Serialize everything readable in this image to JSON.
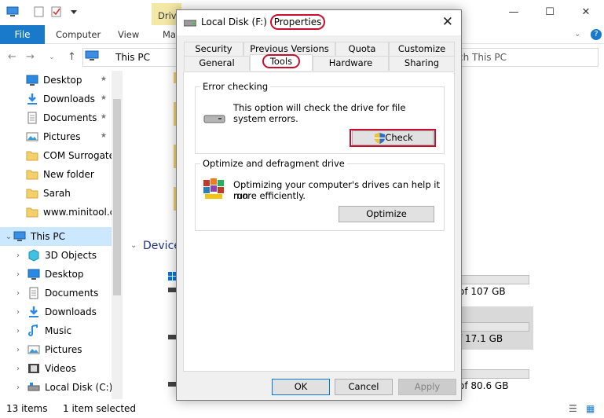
{
  "explorer": {
    "ribbon_contextual_tab": "Drive",
    "ribbon_tabs": [
      "File",
      "Computer",
      "View",
      "Ma"
    ],
    "address": "This PC",
    "search_placeholder": "ch This PC",
    "nav_items": [
      {
        "label": "Desktop",
        "icon": "desktop-icon",
        "pinned": true
      },
      {
        "label": "Downloads",
        "icon": "downloads-icon",
        "pinned": true
      },
      {
        "label": "Documents",
        "icon": "documents-icon",
        "pinned": true
      },
      {
        "label": "Pictures",
        "icon": "pictures-icon",
        "pinned": true
      },
      {
        "label": "COM Surrogate",
        "icon": "folder-icon",
        "pinned": false
      },
      {
        "label": "New folder",
        "icon": "folder-icon",
        "pinned": false
      },
      {
        "label": "Sarah",
        "icon": "folder-icon",
        "pinned": false
      },
      {
        "label": "www.minitool.cc",
        "icon": "folder-icon",
        "pinned": false
      },
      {
        "label": "This PC",
        "icon": "this-pc-icon",
        "pinned": false,
        "selected": true,
        "expanded": true
      },
      {
        "label": "3D Objects",
        "icon": "3d-objects-icon",
        "pinned": false
      },
      {
        "label": "Desktop",
        "icon": "desktop-icon",
        "pinned": false
      },
      {
        "label": "Documents",
        "icon": "documents-icon",
        "pinned": false
      },
      {
        "label": "Downloads",
        "icon": "downloads-icon",
        "pinned": false
      },
      {
        "label": "Music",
        "icon": "music-icon",
        "pinned": false
      },
      {
        "label": "Pictures",
        "icon": "pictures-icon",
        "pinned": false
      },
      {
        "label": "Videos",
        "icon": "videos-icon",
        "pinned": false
      },
      {
        "label": "Local Disk (C:)",
        "icon": "local-disk-icon",
        "pinned": false
      }
    ],
    "devices_header": "Device",
    "drives": [
      {
        "label_suffix": ":)",
        "capacity": "of 107 GB",
        "used_fraction": 0.0
      },
      {
        "label_suffix": ")",
        "capacity": "f 17.1 GB",
        "used_fraction": 0.0
      },
      {
        "label_suffix": ")",
        "capacity": "of 80.6 GB",
        "used_fraction": 0.0
      }
    ],
    "status": {
      "items": "13 items",
      "selected": "1 item selected"
    }
  },
  "dialog": {
    "title_prefix": "Local Disk (F:)",
    "title_suffix": "Properties",
    "tabs_row1": [
      "Security",
      "Previous Versions",
      "Quota",
      "Customize"
    ],
    "tabs_row2": [
      "General",
      "Tools",
      "Hardware",
      "Sharing"
    ],
    "active_tab": "Tools",
    "error_checking": {
      "title": "Error checking",
      "text_line1": "This option will check the drive for file",
      "text_line2": "system errors.",
      "button": "Check"
    },
    "optimize": {
      "title": "Optimize and defragment drive",
      "text_line1": "Optimizing your computer's drives can help it run",
      "text_line2": "more efficiently.",
      "button": "Optimize"
    },
    "buttons": {
      "ok": "OK",
      "cancel": "Cancel",
      "apply": "Apply"
    }
  },
  "colors": {
    "accent": "#1979ca",
    "highlight": "#c8102e",
    "selection": "#cce8ff"
  }
}
